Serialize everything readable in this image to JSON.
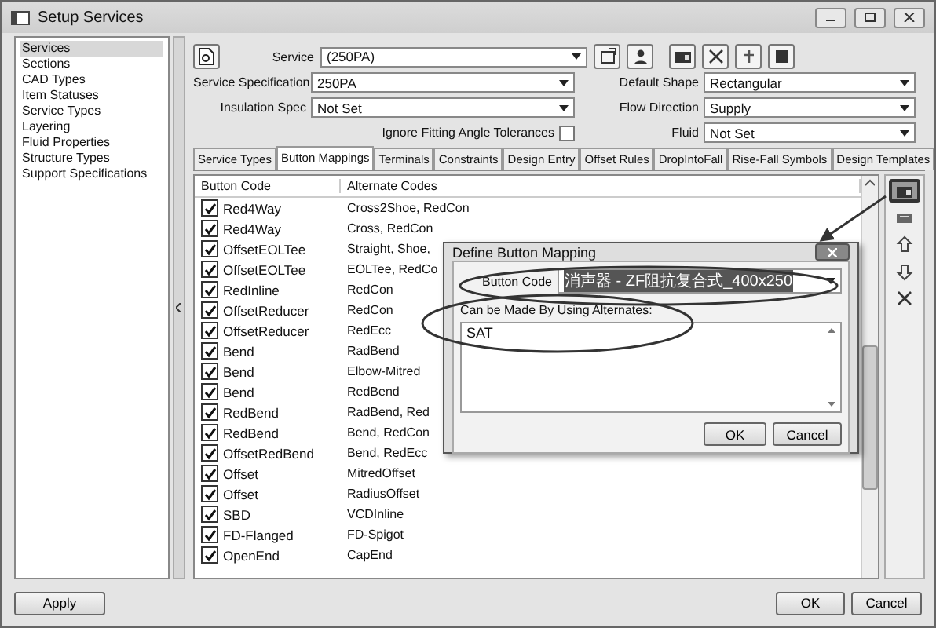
{
  "window": {
    "title": "Setup Services"
  },
  "sidebar": {
    "items": [
      {
        "label": "Services",
        "selected": true
      },
      {
        "label": "Sections",
        "selected": false
      },
      {
        "label": "CAD Types",
        "selected": false
      },
      {
        "label": "Item Statuses",
        "selected": false
      },
      {
        "label": "Service Types",
        "selected": false
      },
      {
        "label": "Layering",
        "selected": false
      },
      {
        "label": "Fluid Properties",
        "selected": false
      },
      {
        "label": "Structure Types",
        "selected": false
      },
      {
        "label": "Support Specifications",
        "selected": false
      }
    ]
  },
  "service": {
    "label": "Service",
    "value": "(250PA)"
  },
  "top_toolbar": [
    {
      "kind": "export"
    },
    {
      "kind": "person"
    },
    {
      "kind": "card"
    },
    {
      "kind": "delete"
    },
    {
      "kind": "pin"
    },
    {
      "kind": "stop"
    }
  ],
  "fields": [
    {
      "label": "Service Specification",
      "value": "250PA"
    },
    {
      "label": "Default Shape",
      "value": "Rectangular"
    },
    {
      "label": "Insulation Spec",
      "value": "Not Set"
    },
    {
      "label": "Flow Direction",
      "value": "Supply"
    }
  ],
  "ignore_tolerances": {
    "label": "Ignore Fitting Angle Tolerances",
    "checked": false
  },
  "fluid": {
    "label": "Fluid",
    "value": "Not Set"
  },
  "tabs": [
    {
      "label": "Service Types",
      "selected": false
    },
    {
      "label": "Button Mappings",
      "selected": true
    },
    {
      "label": "Terminals",
      "selected": false
    },
    {
      "label": "Constraints",
      "selected": false
    },
    {
      "label": "Design Entry",
      "selected": false
    },
    {
      "label": "Offset Rules",
      "selected": false
    },
    {
      "label": "DropIntoFall",
      "selected": false
    },
    {
      "label": "Rise-Fall Symbols",
      "selected": false
    },
    {
      "label": "Design Templates",
      "selected": false
    }
  ],
  "table": {
    "columns": [
      "Button Code",
      "Alternate Codes"
    ],
    "rows": [
      {
        "code": "Red4Way",
        "alternates": "Cross2Shoe, RedCon",
        "checked": true
      },
      {
        "code": "Red4Way",
        "alternates": "Cross, RedCon",
        "checked": true
      },
      {
        "code": "OffsetEOLTee",
        "alternates": "Straight, Shoe,",
        "checked": true
      },
      {
        "code": "OffsetEOLTee",
        "alternates": "EOLTee, RedCo",
        "checked": true
      },
      {
        "code": "RedInline",
        "alternates": "RedCon",
        "checked": true
      },
      {
        "code": "OffsetReducer",
        "alternates": "RedCon",
        "checked": true
      },
      {
        "code": "OffsetReducer",
        "alternates": "RedEcc",
        "checked": true
      },
      {
        "code": "Bend",
        "alternates": "RadBend",
        "checked": true
      },
      {
        "code": "Bend",
        "alternates": "Elbow-Mitred",
        "checked": true
      },
      {
        "code": "Bend",
        "alternates": "RedBend",
        "checked": true
      },
      {
        "code": "RedBend",
        "alternates": "RadBend, Red",
        "checked": true
      },
      {
        "code": "RedBend",
        "alternates": "Bend, RedCon",
        "checked": true
      },
      {
        "code": "OffsetRedBend",
        "alternates": "Bend, RedEcc",
        "checked": true
      },
      {
        "code": "Offset",
        "alternates": "MitredOffset",
        "checked": true
      },
      {
        "code": "Offset",
        "alternates": "RadiusOffset",
        "checked": true
      },
      {
        "code": "SBD",
        "alternates": "VCDInline",
        "checked": true
      },
      {
        "code": "FD-Flanged",
        "alternates": "FD-Spigot",
        "checked": true
      },
      {
        "code": "OpenEnd",
        "alternates": "CapEnd",
        "checked": true
      }
    ]
  },
  "side_toolbar": [
    {
      "kind": "card",
      "highlighted": true
    },
    {
      "kind": "mapping",
      "highlighted": false
    },
    {
      "kind": "up",
      "highlighted": false
    },
    {
      "kind": "down",
      "highlighted": false
    },
    {
      "kind": "delete",
      "highlighted": false
    }
  ],
  "dialog": {
    "title": "Define Button Mapping",
    "button_code_label": "Button Code",
    "button_code_value": "消声器 - ZF阻抗复合式_400x250",
    "alternates_label": "Can be Made By Using Alternates:",
    "alternates_value": "SAT",
    "buttons": [
      "OK",
      "Cancel"
    ]
  },
  "buttons": {
    "apply": "Apply",
    "ok": "OK",
    "cancel": "Cancel"
  }
}
